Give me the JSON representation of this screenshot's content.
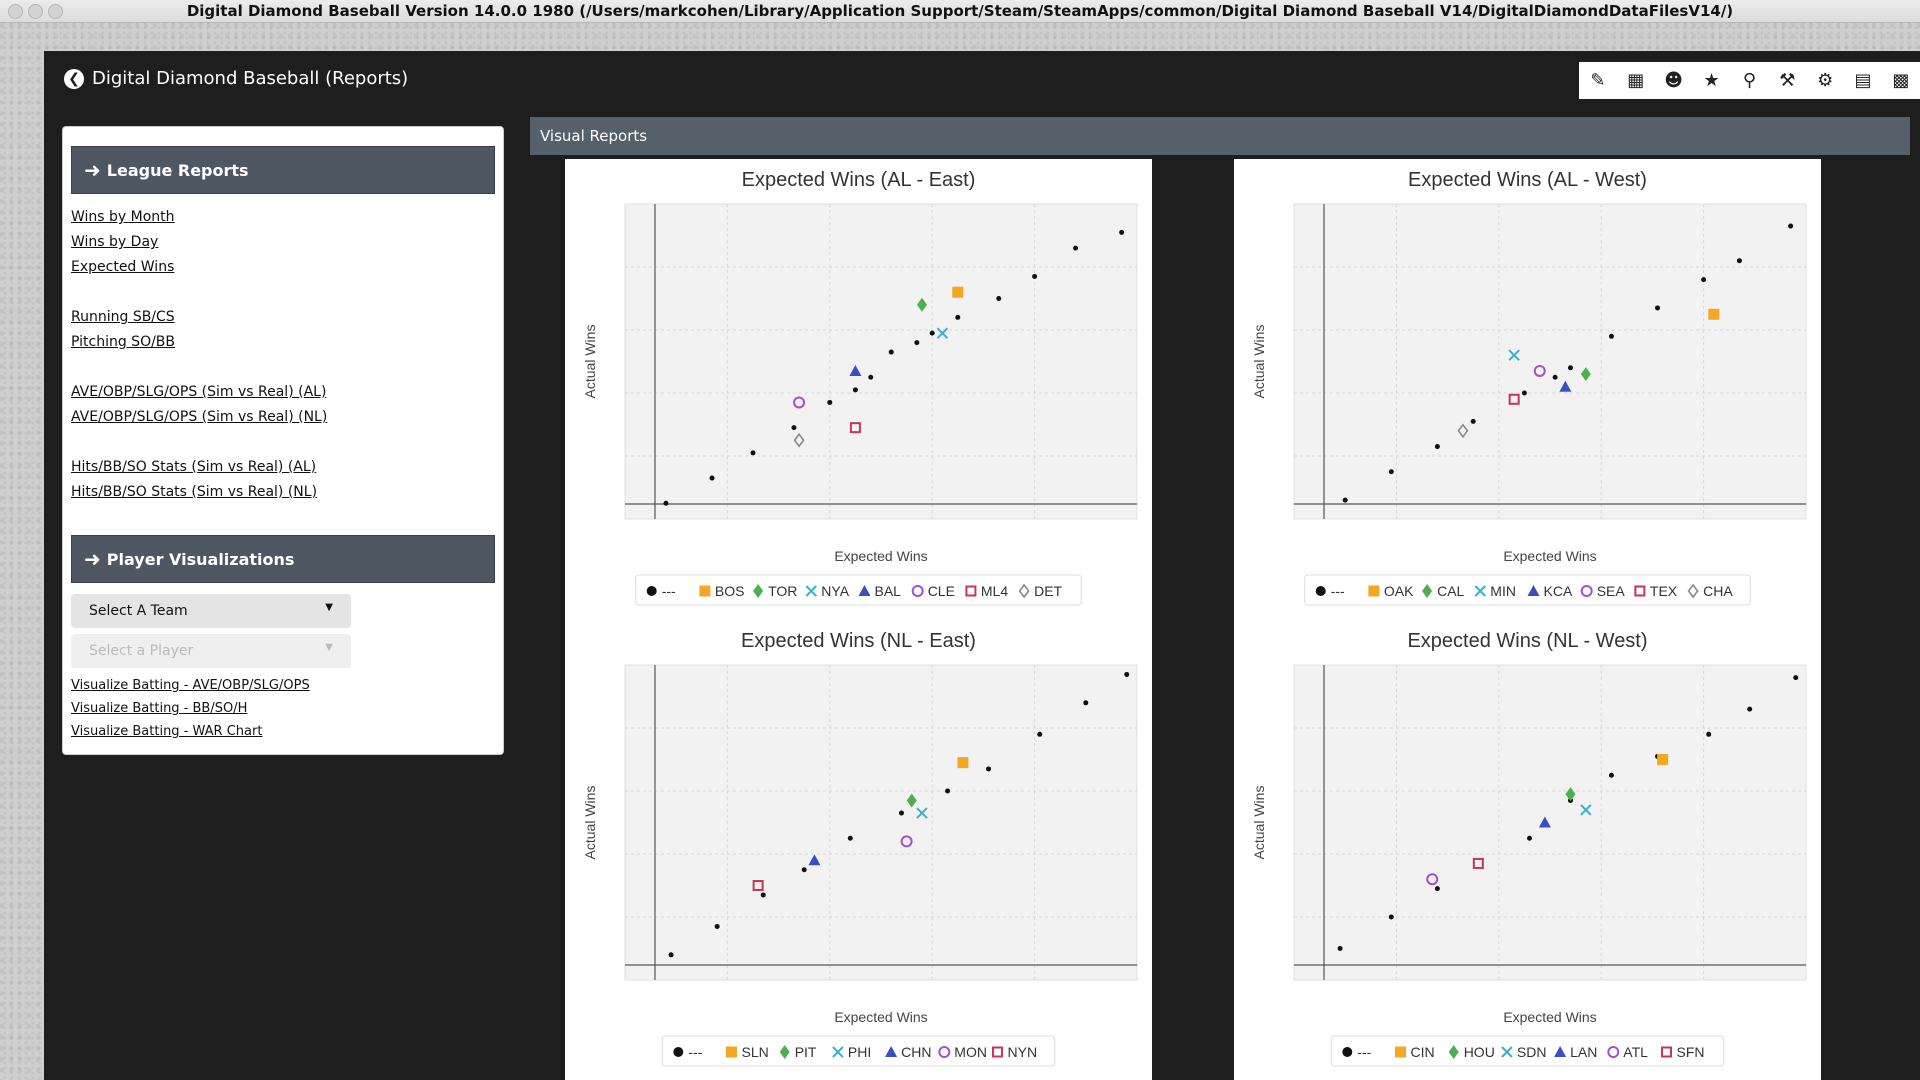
{
  "window": {
    "title": "Digital Diamond Baseball Version 14.0.0 1980  (/Users/markcohen/Library/Application Support/Steam/SteamApps/common/Digital Diamond Baseball V14/DigitalDiamondDataFilesV14/)"
  },
  "app": {
    "title": "Digital Diamond Baseball (Reports)",
    "toolbar_icons": [
      "pencil-icon",
      "grid-icon",
      "people-icon",
      "trophy-icon",
      "search-icon",
      "hammer-icon",
      "gear-icon",
      "clipboard-icon",
      "folder-icon"
    ]
  },
  "sidebar": {
    "league_header": "League Reports",
    "league_links": [
      "Wins by Month",
      "Wins by Day",
      "Expected Wins",
      "Running SB/CS",
      "Pitching SO/BB",
      "AVE/OBP/SLG/OPS (Sim vs Real) (AL)",
      "AVE/OBP/SLG/OPS (Sim vs Real) (NL)",
      "Hits/BB/SO Stats (Sim vs Real) (AL)",
      "Hits/BB/SO Stats (Sim vs Real) (NL)"
    ],
    "player_header": "Player Visualizations",
    "team_select": "Select A Team",
    "player_select": "Select a Player",
    "viz_links": [
      "Visualize Batting - AVE/OBP/SLG/OPS",
      "Visualize Batting - BB/SO/H",
      "Visualize Batting - WAR Chart"
    ]
  },
  "main": {
    "header": "Visual Reports"
  },
  "colors": {
    "orange": "#f5a623",
    "green": "#4cb04c",
    "cyan": "#3ab0d0",
    "blue": "#3b4fc4",
    "purple": "#a64ecf",
    "crimson": "#c8345a",
    "gray": "#888888",
    "black": "#111111"
  },
  "chart_data": [
    {
      "type": "scatter",
      "title": "Expected Wins (AL - East)",
      "xlabel": "Expected Wins",
      "ylabel": "Actual Wins",
      "grid": true,
      "xlim": [
        0,
        100
      ],
      "ylim": [
        0,
        100
      ],
      "reference_points": {
        "name": "---",
        "x": [
          8,
          17,
          25,
          33,
          40,
          45,
          48,
          52,
          57,
          60,
          65,
          73,
          80,
          88,
          97
        ],
        "y": [
          5,
          13,
          21,
          29,
          37,
          41,
          45,
          53,
          56,
          59,
          64,
          70,
          77,
          86,
          91
        ]
      },
      "series": [
        {
          "name": "BOS",
          "marker": "square",
          "color": "orange",
          "x": [
            65
          ],
          "y": [
            72
          ]
        },
        {
          "name": "TOR",
          "marker": "diamond",
          "color": "green",
          "x": [
            58
          ],
          "y": [
            68
          ]
        },
        {
          "name": "NYA",
          "marker": "x",
          "color": "cyan",
          "x": [
            62
          ],
          "y": [
            59
          ]
        },
        {
          "name": "BAL",
          "marker": "triangle",
          "color": "blue",
          "x": [
            45
          ],
          "y": [
            47
          ]
        },
        {
          "name": "CLE",
          "marker": "circle",
          "color": "purple",
          "x": [
            34
          ],
          "y": [
            37
          ]
        },
        {
          "name": "ML4",
          "marker": "square-open",
          "color": "crimson",
          "x": [
            45
          ],
          "y": [
            29
          ]
        },
        {
          "name": "DET",
          "marker": "diamond-open",
          "color": "gray",
          "x": [
            34
          ],
          "y": [
            25
          ]
        }
      ]
    },
    {
      "type": "scatter",
      "title": "Expected Wins (AL - West)",
      "xlabel": "Expected Wins",
      "ylabel": "Actual Wins",
      "grid": true,
      "xlim": [
        0,
        100
      ],
      "ylim": [
        0,
        100
      ],
      "reference_points": {
        "name": "---",
        "x": [
          10,
          19,
          28,
          35,
          45,
          51,
          54,
          62,
          71,
          80,
          87,
          97
        ],
        "y": [
          6,
          15,
          23,
          31,
          40,
          45,
          48,
          58,
          67,
          76,
          82,
          93
        ]
      },
      "series": [
        {
          "name": "OAK",
          "marker": "square",
          "color": "orange",
          "x": [
            82
          ],
          "y": [
            65
          ]
        },
        {
          "name": "CAL",
          "marker": "diamond",
          "color": "green",
          "x": [
            57
          ],
          "y": [
            46
          ]
        },
        {
          "name": "MIN",
          "marker": "x",
          "color": "cyan",
          "x": [
            43
          ],
          "y": [
            52
          ]
        },
        {
          "name": "KCA",
          "marker": "triangle",
          "color": "blue",
          "x": [
            53
          ],
          "y": [
            42
          ]
        },
        {
          "name": "SEA",
          "marker": "circle",
          "color": "purple",
          "x": [
            48
          ],
          "y": [
            47
          ]
        },
        {
          "name": "TEX",
          "marker": "square-open",
          "color": "crimson",
          "x": [
            43
          ],
          "y": [
            38
          ]
        },
        {
          "name": "CHA",
          "marker": "diamond-open",
          "color": "gray",
          "x": [
            33
          ],
          "y": [
            28
          ]
        }
      ]
    },
    {
      "type": "scatter",
      "title": "Expected Wins (NL - East)",
      "xlabel": "Expected Wins",
      "ylabel": "Actual Wins",
      "grid": true,
      "xlim": [
        0,
        100
      ],
      "ylim": [
        0,
        100
      ],
      "reference_points": {
        "name": "---",
        "x": [
          9,
          18,
          27,
          35,
          44,
          54,
          63,
          71,
          81,
          90,
          98
        ],
        "y": [
          8,
          17,
          27,
          35,
          45,
          53,
          60,
          67,
          78,
          88,
          97
        ]
      },
      "series": [
        {
          "name": "SLN",
          "marker": "square",
          "color": "orange",
          "x": [
            66
          ],
          "y": [
            69
          ]
        },
        {
          "name": "PIT",
          "marker": "diamond",
          "color": "green",
          "x": [
            56
          ],
          "y": [
            57
          ]
        },
        {
          "name": "PHI",
          "marker": "x",
          "color": "cyan",
          "x": [
            58
          ],
          "y": [
            53
          ]
        },
        {
          "name": "CHN",
          "marker": "triangle",
          "color": "blue",
          "x": [
            37
          ],
          "y": [
            38
          ]
        },
        {
          "name": "MON",
          "marker": "circle",
          "color": "purple",
          "x": [
            55
          ],
          "y": [
            44
          ]
        },
        {
          "name": "NYN",
          "marker": "square-open",
          "color": "crimson",
          "x": [
            26
          ],
          "y": [
            30
          ]
        }
      ]
    },
    {
      "type": "scatter",
      "title": "Expected Wins (NL - West)",
      "xlabel": "Expected Wins",
      "ylabel": "Actual Wins",
      "grid": true,
      "xlim": [
        0,
        100
      ],
      "ylim": [
        0,
        100
      ],
      "reference_points": {
        "name": "---",
        "x": [
          9,
          19,
          28,
          46,
          54,
          62,
          71,
          81,
          89,
          98
        ],
        "y": [
          10,
          20,
          29,
          45,
          57,
          65,
          71,
          78,
          86,
          96
        ]
      },
      "series": [
        {
          "name": "CIN",
          "marker": "square",
          "color": "orange",
          "x": [
            72
          ],
          "y": [
            70
          ]
        },
        {
          "name": "HOU",
          "marker": "diamond",
          "color": "green",
          "x": [
            54
          ],
          "y": [
            59
          ]
        },
        {
          "name": "SDN",
          "marker": "x",
          "color": "cyan",
          "x": [
            57
          ],
          "y": [
            54
          ]
        },
        {
          "name": "LAN",
          "marker": "triangle",
          "color": "blue",
          "x": [
            49
          ],
          "y": [
            50
          ]
        },
        {
          "name": "ATL",
          "marker": "circle",
          "color": "purple",
          "x": [
            27
          ],
          "y": [
            32
          ]
        },
        {
          "name": "SFN",
          "marker": "square-open",
          "color": "crimson",
          "x": [
            36
          ],
          "y": [
            37
          ]
        }
      ]
    }
  ]
}
